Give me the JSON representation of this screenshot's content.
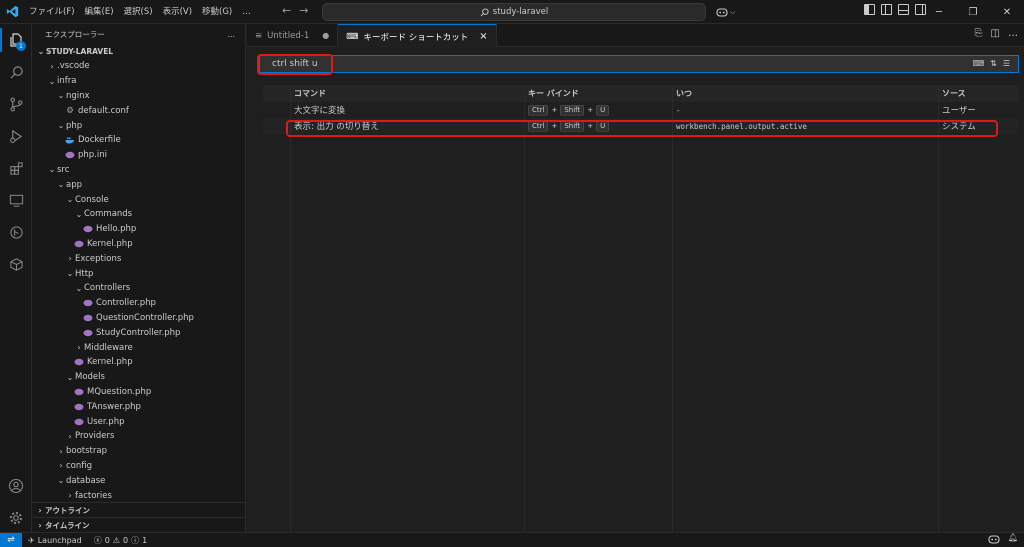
{
  "titlebar": {
    "menu": [
      "ファイル(F)",
      "編集(E)",
      "選択(S)",
      "表示(V)",
      "移動(G)",
      "…"
    ],
    "search_text": "study-laravel",
    "copilot_caret": "⌵"
  },
  "activity": {
    "explorer_badge": "1"
  },
  "sidebar": {
    "title": "エクスプローラー",
    "more": "…",
    "root": "STUDY-LARAVEL",
    "tree": [
      {
        "label": ".vscode",
        "level": 1,
        "type": "folder",
        "open": false
      },
      {
        "label": "infra",
        "level": 1,
        "type": "folder",
        "open": true
      },
      {
        "label": "nginx",
        "level": 2,
        "type": "folder",
        "open": true
      },
      {
        "label": "default.conf",
        "level": 3,
        "type": "gear"
      },
      {
        "label": "php",
        "level": 2,
        "type": "folder",
        "open": true
      },
      {
        "label": "Dockerfile",
        "level": 3,
        "type": "docker"
      },
      {
        "label": "php.ini",
        "level": 3,
        "type": "ini"
      },
      {
        "label": "src",
        "level": 1,
        "type": "folder",
        "open": true
      },
      {
        "label": "app",
        "level": 2,
        "type": "folder",
        "open": true
      },
      {
        "label": "Console",
        "level": 3,
        "type": "folder",
        "open": true
      },
      {
        "label": "Commands",
        "level": 4,
        "type": "folder",
        "open": true
      },
      {
        "label": "Hello.php",
        "level": 5,
        "type": "php"
      },
      {
        "label": "Kernel.php",
        "level": 4,
        "type": "php"
      },
      {
        "label": "Exceptions",
        "level": 3,
        "type": "folder",
        "open": false
      },
      {
        "label": "Http",
        "level": 3,
        "type": "folder",
        "open": true
      },
      {
        "label": "Controllers",
        "level": 4,
        "type": "folder",
        "open": true
      },
      {
        "label": "Controller.php",
        "level": 5,
        "type": "php"
      },
      {
        "label": "QuestionController.php",
        "level": 5,
        "type": "php"
      },
      {
        "label": "StudyController.php",
        "level": 5,
        "type": "php"
      },
      {
        "label": "Middleware",
        "level": 4,
        "type": "folder",
        "open": false
      },
      {
        "label": "Kernel.php",
        "level": 4,
        "type": "php"
      },
      {
        "label": "Models",
        "level": 3,
        "type": "folder",
        "open": true
      },
      {
        "label": "MQuestion.php",
        "level": 4,
        "type": "php"
      },
      {
        "label": "TAnswer.php",
        "level": 4,
        "type": "php"
      },
      {
        "label": "User.php",
        "level": 4,
        "type": "php"
      },
      {
        "label": "Providers",
        "level": 3,
        "type": "folder",
        "open": false
      },
      {
        "label": "bootstrap",
        "level": 2,
        "type": "folder",
        "open": false
      },
      {
        "label": "config",
        "level": 2,
        "type": "folder",
        "open": false
      },
      {
        "label": "database",
        "level": 2,
        "type": "folder",
        "open": true
      },
      {
        "label": "factories",
        "level": 3,
        "type": "folder",
        "open": false
      }
    ],
    "outline": "アウトライン",
    "timeline": "タイムライン"
  },
  "tabs": [
    {
      "label": "Untitled-1",
      "dirty": "●"
    },
    {
      "label": "キーボード ショートカット",
      "close": "×"
    }
  ],
  "search": {
    "value": "ctrl shift u"
  },
  "table": {
    "headers": [
      "コマンド",
      "キー バインド",
      "いつ",
      "ソース"
    ],
    "rows": [
      {
        "command": "大文字に変換",
        "keys": [
          "Ctrl",
          "Shift",
          "U"
        ],
        "when": "-",
        "source": "ユーザー"
      },
      {
        "command": "表示: 出力 の切り替え",
        "keys": [
          "Ctrl",
          "Shift",
          "U"
        ],
        "when": "workbench.panel.output.active",
        "source": "システム"
      }
    ]
  },
  "status": {
    "launchpad": "Launchpad",
    "errors": "0",
    "warnings": "0",
    "info": "1"
  },
  "colors": {
    "accent": "#0078d4",
    "highlight": "#e01818",
    "php": "#a074c4",
    "docker": "#4d9ff0"
  }
}
